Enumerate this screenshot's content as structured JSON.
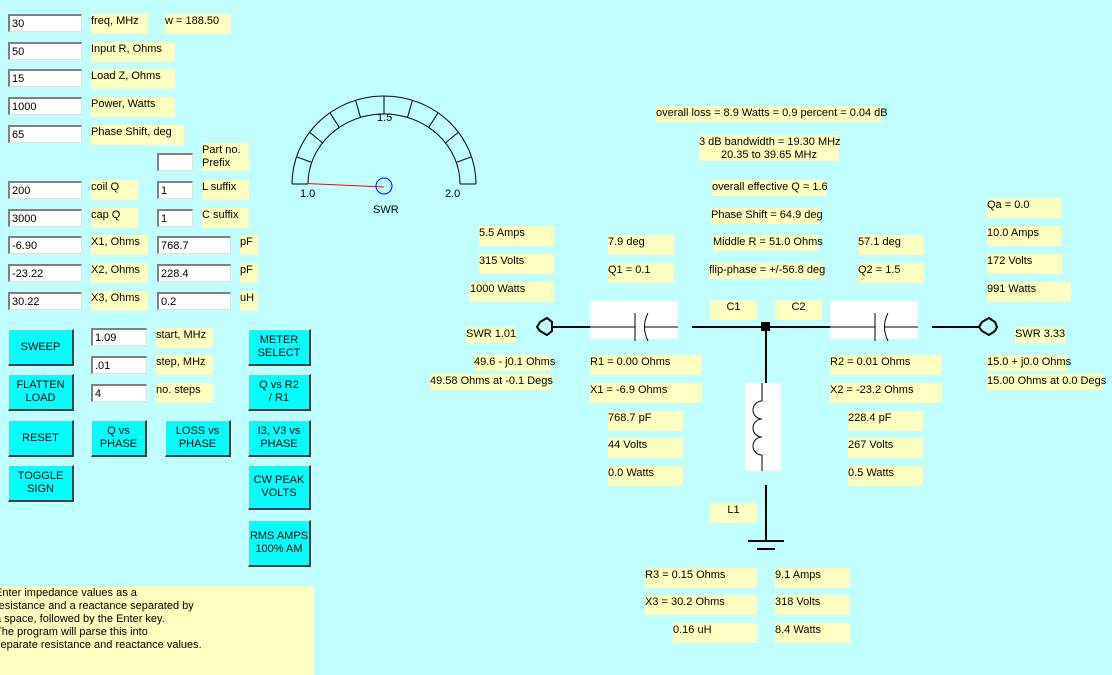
{
  "inputs": {
    "freq": {
      "value": "30",
      "label": "freq, MHz"
    },
    "input_r": {
      "value": "50",
      "label": "Input R, Ohms"
    },
    "load_z": {
      "value": "15",
      "label": "Load Z, Ohms"
    },
    "power": {
      "value": "1000",
      "label": "Power, Watts"
    },
    "phase_shift": {
      "value": "65",
      "label": "Phase Shift, deg"
    },
    "coil_q": {
      "value": "200",
      "label": "coil Q"
    },
    "cap_q": {
      "value": "3000",
      "label": "cap Q"
    },
    "x1": {
      "value": "-6.90",
      "label": "X1, Ohms"
    },
    "x2": {
      "value": "-23.22",
      "label": "X2, Ohms"
    },
    "x3": {
      "value": "30.22",
      "label": "X3, Ohms"
    },
    "part_prefix": {
      "value": "",
      "label_line1": "Part no.",
      "label_line2": "Prefix"
    },
    "l_suffix": {
      "value": "1",
      "label": "L suffix"
    },
    "c_suffix": {
      "value": "1",
      "label": "C suffix"
    },
    "c1_value": {
      "value": "768.7",
      "unit": "pF"
    },
    "c2_value": {
      "value": "228.4",
      "unit": "pF"
    },
    "l1_value": {
      "value": "0.2",
      "unit": "uH"
    },
    "sweep_start": {
      "value": "1.09",
      "label": "start, MHz"
    },
    "sweep_step": {
      "value": ".01",
      "label": "step, MHz"
    },
    "sweep_steps": {
      "value": "4",
      "label": "no. steps"
    }
  },
  "omega": "w = 188.50",
  "buttons": {
    "sweep": "SWEEP",
    "flatten_load": "FLATTEN\nLOAD",
    "reset": "RESET",
    "toggle_sign": "TOGGLE\nSIGN",
    "q_vs_phase": "Q vs\nPHASE",
    "loss_vs_phase": "LOSS vs\nPHASE",
    "meter_select": "METER\nSELECT",
    "q_vs_r2r1": "Q vs   R2\n/ R1",
    "i3v3_vs_phase": "I3, V3 vs\nPHASE",
    "cw_peak_volts": "CW PEAK\nVOLTS",
    "rms_amps": "RMS AMPS\n100% AM"
  },
  "meter": {
    "label": "SWR",
    "scale_min": "1.0",
    "scale_mid": "1.5",
    "scale_max": "2.0",
    "reading": 1.01
  },
  "help_text": [
    "Enter impedance values as a",
    "resistance and a reactance separated by",
    "a space, followed by the Enter key.",
    "The program will parse this into",
    "separate resistance and reactance values."
  ],
  "summary": {
    "overall_loss": "overall loss = 8.9 Watts = 0.9 percent = 0.04 dB",
    "bandwidth": "3 dB bandwidth = 19.30 MHz",
    "bandwidth_range": "20.35 to 39.65 MHz",
    "effective_q": "overall effective Q = 1.6",
    "phase_shift": "Phase Shift = 64.9 deg",
    "middle_r": "Middle R = 51.0 Ohms",
    "flip_phase": "flip-phase = +/-56.8 deg"
  },
  "input_side": {
    "amps": "5.5 Amps",
    "volts": "315 Volts",
    "watts": "1000 Watts",
    "swr": "SWR 1.01",
    "impedance": "49.6 - j0.1 Ohms",
    "polar": "49.58 Ohms at -0.1 Degs"
  },
  "c1": {
    "label": "C1",
    "phase": "7.9 deg",
    "q": "Q1 = 0.1",
    "r": "R1 = 0.00 Ohms",
    "x": "X1 = -6.9 Ohms",
    "cap": "768.7 pF",
    "volts": "44 Volts",
    "watts": "0.0 Watts"
  },
  "c2": {
    "label": "C2",
    "phase": "57.1 deg",
    "q": "Q2 = 1.5",
    "r": "R2 = 0.01 Ohms",
    "x": "X2 = -23.2 Ohms",
    "cap": "228.4 pF",
    "volts": "267 Volts",
    "watts": "0.5 Watts"
  },
  "l1": {
    "label": "L1",
    "r": "R3 = 0.15 Ohms",
    "x": "X3 = 30.2 Ohms",
    "ind": "0.16 uH",
    "amps": "9.1 Amps",
    "volts": "318 Volts",
    "watts": "8.4 Watts"
  },
  "output_side": {
    "qa": "Qa = 0.0",
    "amps": "10.0 Amps",
    "volts": "172 Volts",
    "watts": "991 Watts",
    "swr": "SWR 3.33",
    "impedance": "15.0 + j0.0 Ohms",
    "polar": "15.00 Ohms at 0.0 Degs"
  }
}
